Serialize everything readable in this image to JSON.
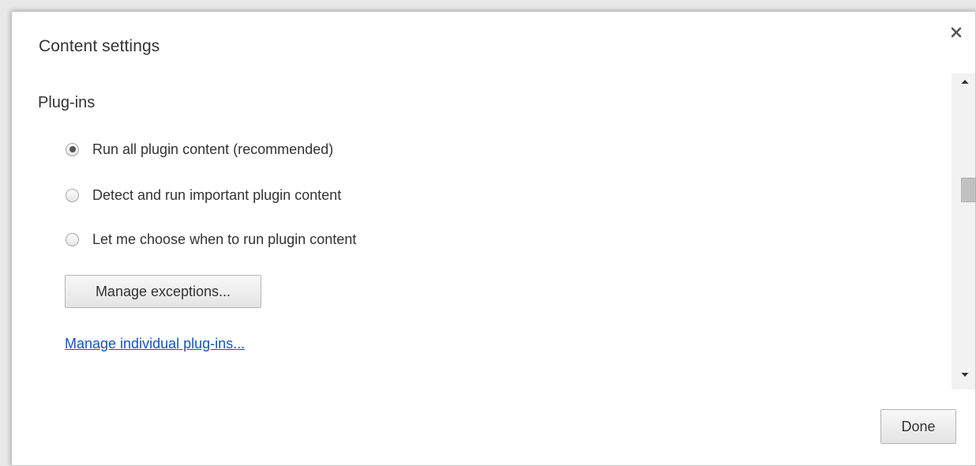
{
  "dialog": {
    "title": "Content settings",
    "close_icon": "close-icon"
  },
  "plugins_section": {
    "title": "Plug-ins",
    "options": [
      {
        "label": "Run all plugin content (recommended)",
        "checked": true
      },
      {
        "label": "Detect and run important plugin content",
        "checked": false
      },
      {
        "label": "Let me choose when to run plugin content",
        "checked": false
      }
    ],
    "manage_exceptions_label": "Manage exceptions...",
    "manage_individual_link": "Manage individual plug-ins..."
  },
  "footer": {
    "done_label": "Done"
  },
  "colors": {
    "link": "#1155cc",
    "text": "#333333",
    "background": "#ffffff"
  }
}
